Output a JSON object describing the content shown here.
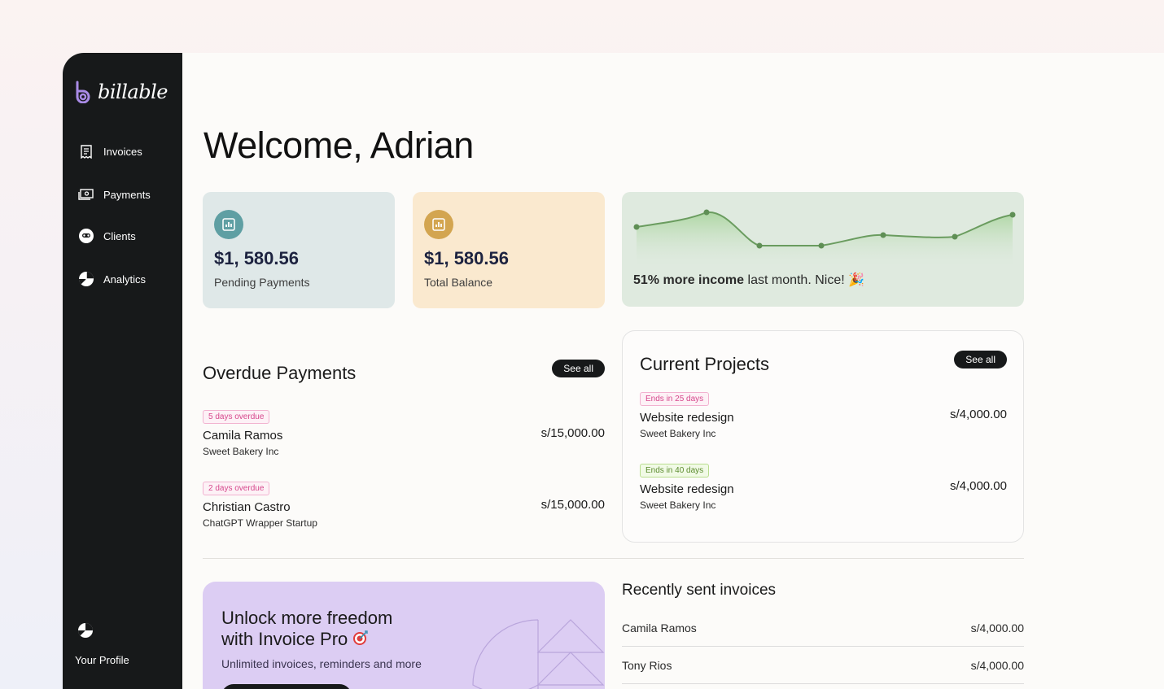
{
  "app": {
    "brand": "billable"
  },
  "sidebar": {
    "items": [
      {
        "label": "Invoices",
        "icon": "receipt-icon"
      },
      {
        "label": "Payments",
        "icon": "money-icon"
      },
      {
        "label": "Clients",
        "icon": "client-icon"
      },
      {
        "label": "Analytics",
        "icon": "pie-chart-icon"
      }
    ],
    "profile_label": "Your Profile"
  },
  "welcome": "Welcome, Adrian",
  "stats": [
    {
      "value": "$1, 580.56",
      "label": "Pending Payments",
      "color": "#dfe8e8",
      "icon_color": "#5f9fa3"
    },
    {
      "value": "$1, 580.56",
      "label": "Total Balance",
      "color": "#fae9cf",
      "icon_color": "#d3a550"
    }
  ],
  "income": {
    "caption_bold": "51% more income",
    "caption_rest": "last month. Nice! 🎉",
    "line_color": "#6a9c5f"
  },
  "overdue": {
    "title": "Overdue Payments",
    "see_all": "See all",
    "rows": [
      {
        "tag": "5 days overdue",
        "name": "Camila Ramos",
        "company": "Sweet Bakery Inc",
        "amount": "s/15,000.00"
      },
      {
        "tag": "2 days overdue",
        "name": "Christian Castro",
        "company": "ChatGPT Wrapper Startup",
        "amount": "s/15,000.00"
      }
    ]
  },
  "projects": {
    "title": "Current Projects",
    "see_all": "See all",
    "rows": [
      {
        "tag": "Ends in 25 days",
        "tag_style": "pink",
        "name": "Website redesign",
        "company": "Sweet Bakery Inc",
        "amount": "s/4,000.00"
      },
      {
        "tag": "Ends in 40 days",
        "tag_style": "green",
        "name": "Website redesign",
        "company": "Sweet Bakery Inc",
        "amount": "s/4,000.00"
      }
    ]
  },
  "promo": {
    "title_line1": "Unlock more freedom",
    "title_line2": "with Invoice Pro",
    "subtitle": "Unlimited invoices, reminders and more"
  },
  "recent": {
    "title": "Recently sent invoices",
    "rows": [
      {
        "name": "Camila Ramos",
        "amount": "s/4,000.00"
      },
      {
        "name": "Tony Rios",
        "amount": "s/4,000.00"
      }
    ]
  }
}
